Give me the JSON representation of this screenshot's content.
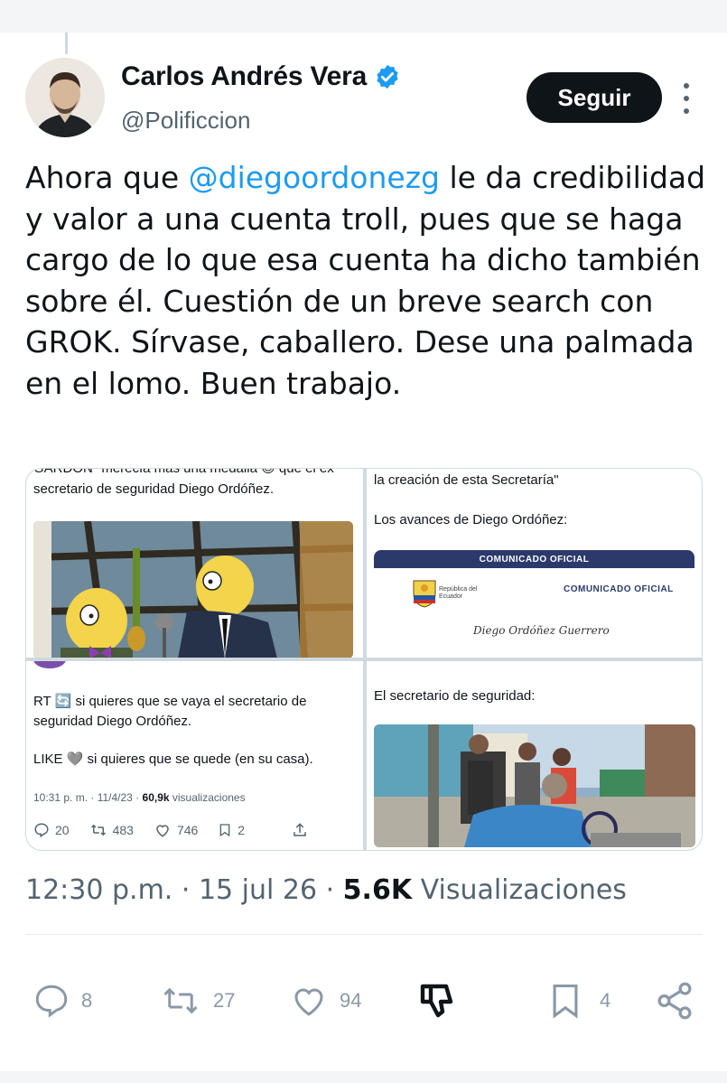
{
  "author": {
    "name": "Carlos Andrés Vera",
    "handle": "@Polificcion",
    "follow_label": "Seguir"
  },
  "tweet": {
    "text_before": "Ahora que ",
    "mention": "@diegoordonezg",
    "text_after": " le da credibilidad y valor a una cuenta troll, pues que se haga cargo de lo que esa cuenta ha dicho también sobre él. Cuestión de un breve search con GROK. Sírvase, caballero. Dese una palmada en el lomo. Buen trabajo."
  },
  "media": {
    "img1": {
      "cut_line": "GARDON \"merecía más una medalla 😉 que el ex",
      "line2": "secretario de seguridad Diego Ordóñez."
    },
    "img2": {
      "line1": "la creación de esta Secretaría\"",
      "line2": "Los avances de Diego Ordóñez:",
      "banner": "COMUNICADO OFICIAL",
      "doc_title": "COMUNICADO OFICIAL",
      "republic": "República del Ecuador",
      "signature": "Diego Ordóñez Guerrero"
    },
    "img3": {
      "line1": "RT 🔄 si quieres que se vaya el secretario de",
      "line2": "seguridad Diego Ordóñez.",
      "line3": "LIKE 🩶 si quieres que se quede (en su casa).",
      "meta_time": "10:31 p. m. · 11/4/23 · ",
      "meta_views": "60,9k",
      "meta_views_label": " visualizaciones",
      "replies": "20",
      "retweets": "483",
      "likes": "746",
      "bookmarks": "2"
    },
    "img4": {
      "line1": "El secretario de seguridad:"
    }
  },
  "timestamp": {
    "time": "12:30 p.m.",
    "date": "15 jul 26",
    "views": "5.6K",
    "views_label": "Visualizaciones"
  },
  "actions": {
    "replies": "8",
    "retweets": "27",
    "likes": "94",
    "bookmarks": "4"
  },
  "colors": {
    "accent": "#1d9bf0",
    "text": "#0f1419",
    "secondary": "#536471"
  }
}
